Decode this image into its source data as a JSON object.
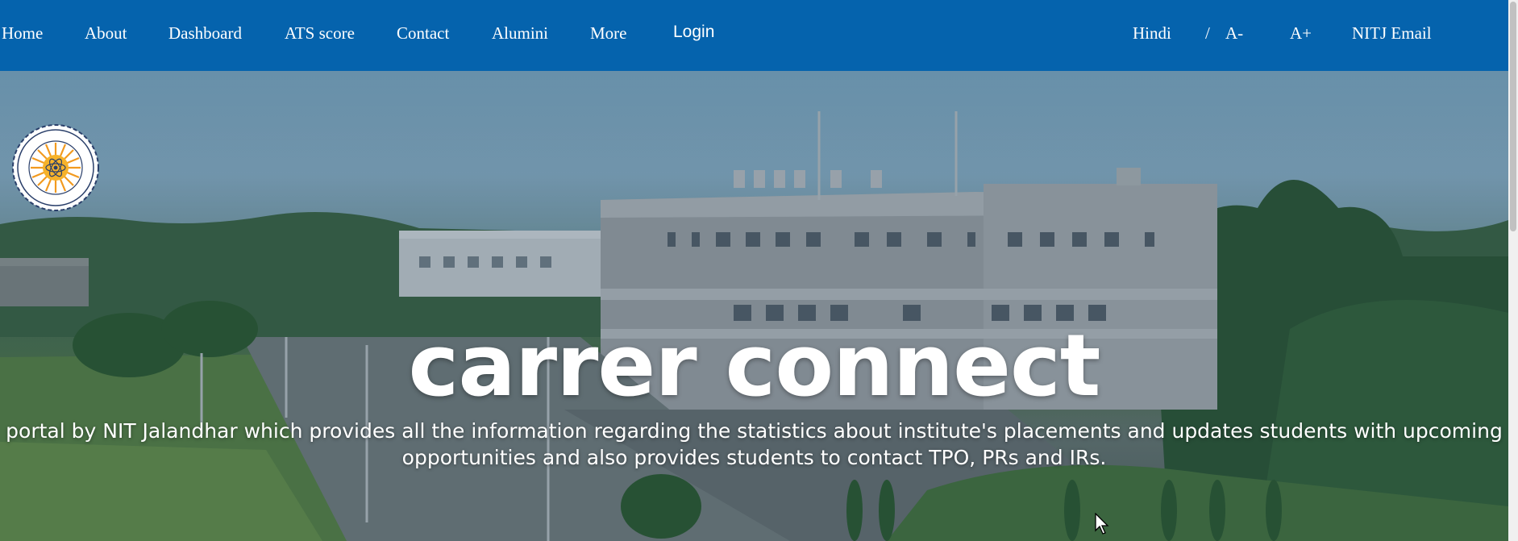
{
  "nav": {
    "items": [
      {
        "label": "Home"
      },
      {
        "label": "About"
      },
      {
        "label": "Dashboard"
      },
      {
        "label": "ATS score"
      },
      {
        "label": "Contact"
      },
      {
        "label": "Alumini"
      },
      {
        "label": "More"
      },
      {
        "label": "Login"
      }
    ],
    "right": {
      "hindi": "Hindi",
      "separator": "/",
      "font_decrease": "A-",
      "font_increase": "A+",
      "email": "NITJ Email"
    }
  },
  "hero": {
    "title": "carrer connect",
    "description": "portal by NIT Jalandhar which provides all the information regarding the statistics about institute's placements and updates students with upcoming opportunities and also provides students to contact TPO, PRs and IRs.",
    "logo": {
      "icon": "nitj-emblem-icon",
      "ring_text": "DR B R AMBEDKAR NATIONAL INSTITUTE OF TECHNOLOGY",
      "bottom_text": "JALANDHAR",
      "motto": "सत्यमेव जयते"
    }
  },
  "colors": {
    "navbar": "#0563ad",
    "text": "#ffffff"
  }
}
